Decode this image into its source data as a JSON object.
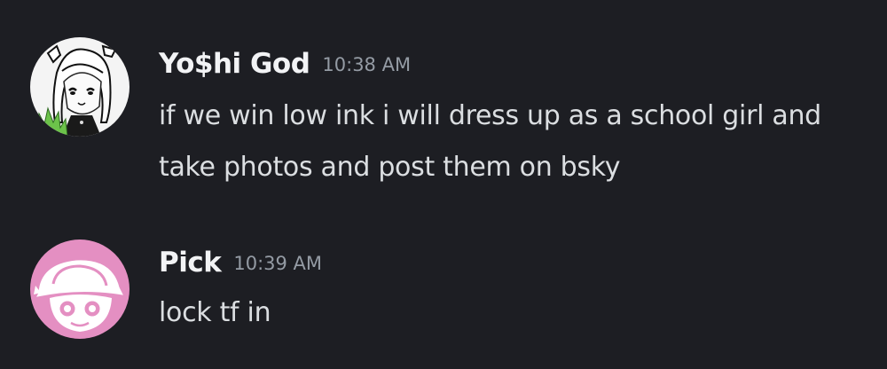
{
  "messages": [
    {
      "username": "Yo$hi God",
      "timestamp": "10:38 AM",
      "content": "if we win low ink i will dress up as a school girl and take photos and post them on bsky",
      "avatar_icon": "anime-girl-avatar-icon"
    },
    {
      "username": "Pick",
      "timestamp": "10:39 AM",
      "content": "lock tf in",
      "avatar_icon": "pink-hat-character-avatar-icon"
    }
  ],
  "colors": {
    "background": "#1d1e23",
    "username": "#f2f3f5",
    "timestamp": "#949ba4",
    "content": "#dbdee1",
    "pick_avatar_bg": "#e48fc2"
  }
}
